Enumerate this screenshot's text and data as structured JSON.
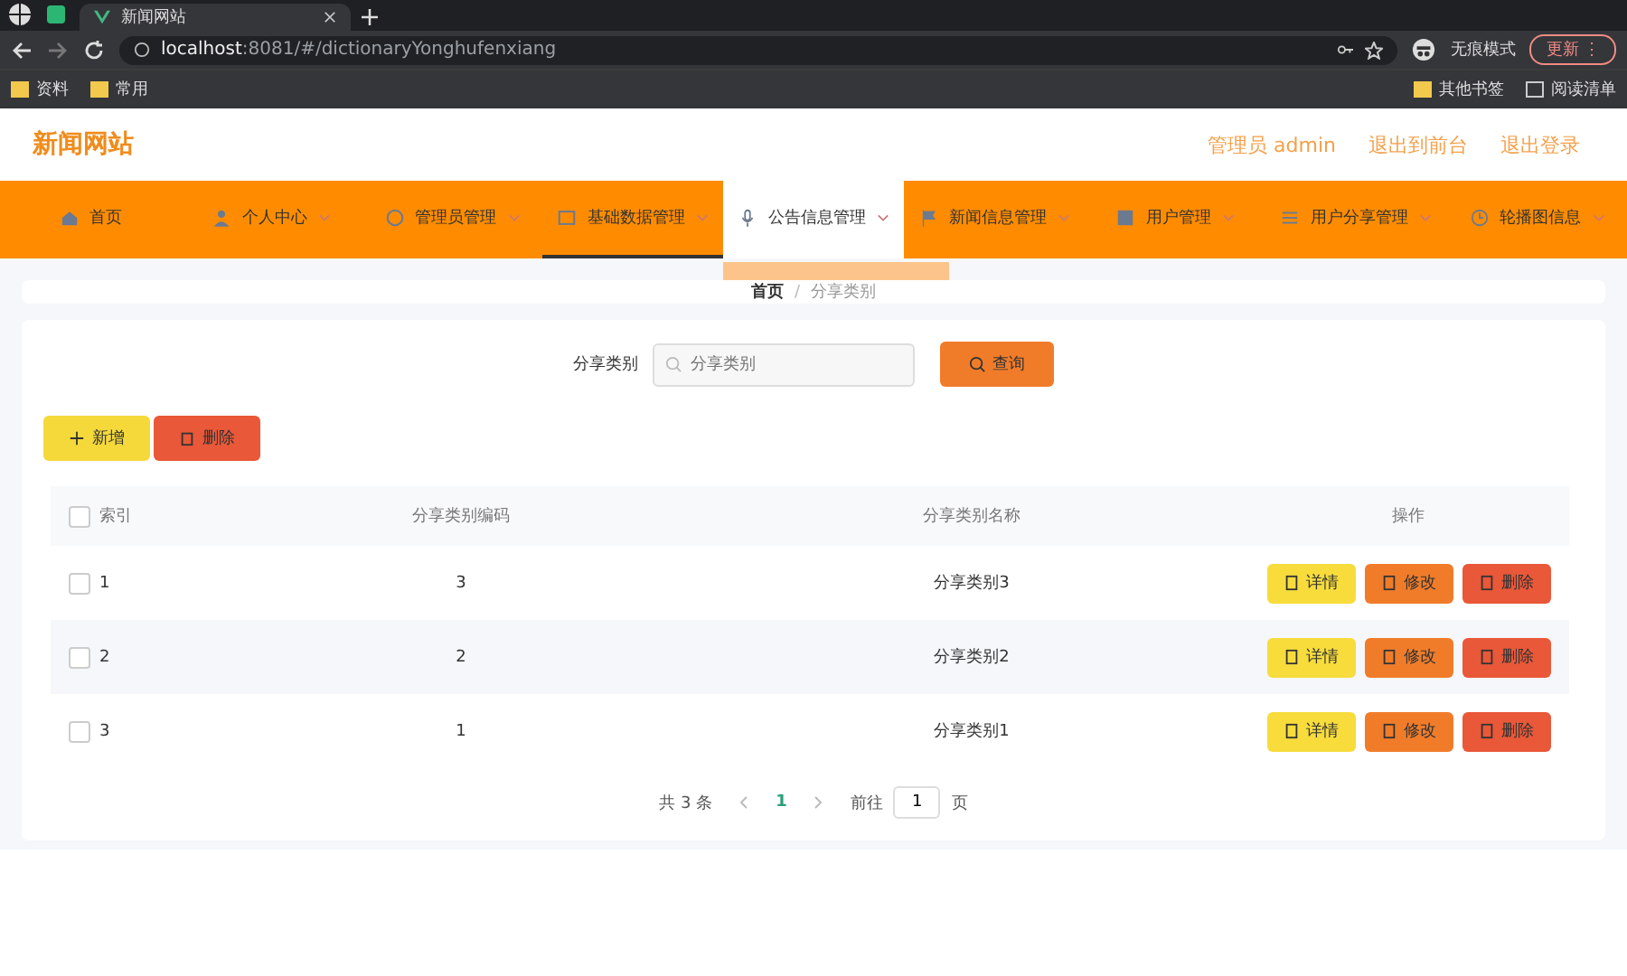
{
  "browser": {
    "tabs": [
      {
        "title": "新闻网站",
        "selected": true
      }
    ],
    "url_host": "localhost",
    "url_rest": ":8081/#/dictionaryYonghufenxiang",
    "incognito": "无痕模式",
    "update": "更新",
    "update_menu": "⋮",
    "bookmarks": [
      "资料",
      "常用"
    ],
    "bookmarks_right": [
      "其他书签",
      "阅读清单"
    ]
  },
  "header": {
    "title": "新闻网站",
    "links": [
      "管理员 admin",
      "退出到前台",
      "退出登录"
    ]
  },
  "nav": [
    {
      "label": "首页",
      "selected": false,
      "open": false,
      "caret": false
    },
    {
      "label": "个人中心",
      "selected": false,
      "open": false,
      "caret": true
    },
    {
      "label": "管理员管理",
      "selected": false,
      "open": false,
      "caret": true
    },
    {
      "label": "基础数据管理",
      "selected": true,
      "open": false,
      "caret": true
    },
    {
      "label": "公告信息管理",
      "selected": false,
      "open": true,
      "caret": true
    },
    {
      "label": "新闻信息管理",
      "selected": false,
      "open": false,
      "caret": true
    },
    {
      "label": "用户管理",
      "selected": false,
      "open": false,
      "caret": true
    },
    {
      "label": "用户分享管理",
      "selected": false,
      "open": false,
      "caret": true
    },
    {
      "label": "轮播图信息",
      "selected": false,
      "open": false,
      "caret": true
    }
  ],
  "breadcrumb": [
    "首页",
    "分享类别"
  ],
  "breadcrumb_separator": "/",
  "search": {
    "label": "分享类别",
    "placeholder": "分享类别",
    "button": "查询"
  },
  "toolbar": {
    "add": "新增",
    "delete": "删除"
  },
  "table": {
    "select_all_checked": false,
    "columns": [
      "索引",
      "分享类别编码",
      "分享类别名称",
      "操作"
    ],
    "rows": [
      {
        "index": "1",
        "code": "3",
        "name": "分享类别3",
        "checked": false,
        "actions": [
          "详情",
          "修改",
          "删除"
        ]
      },
      {
        "index": "2",
        "code": "2",
        "name": "分享类别2",
        "checked": false,
        "actions": [
          "详情",
          "修改",
          "删除"
        ]
      },
      {
        "index": "3",
        "code": "1",
        "name": "分享类别1",
        "checked": false,
        "actions": [
          "详情",
          "修改",
          "删除"
        ]
      }
    ]
  },
  "pagination": {
    "total": "共 3 条",
    "pages": [
      {
        "label": "1",
        "selected": true
      }
    ],
    "goto": "前往",
    "page_input": "1",
    "page_suffix": "页"
  }
}
